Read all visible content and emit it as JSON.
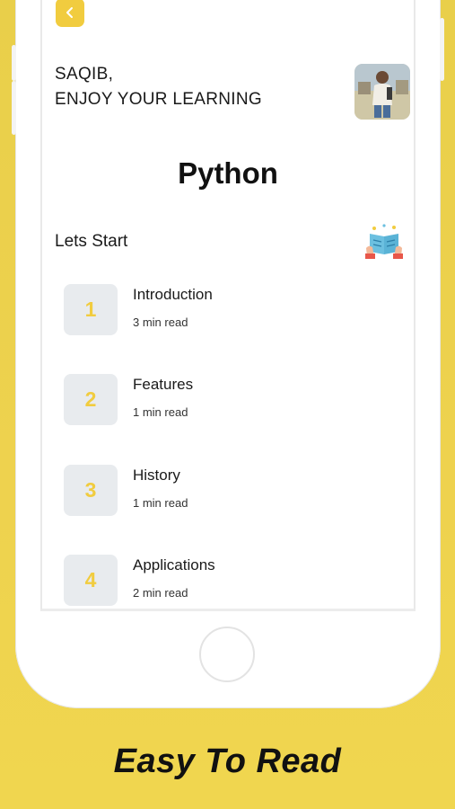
{
  "header": {
    "greeting_line1": "SAQIB,",
    "greeting_line2": "ENJOY YOUR LEARNING"
  },
  "course": {
    "title": "Python"
  },
  "section": {
    "label": "Lets Start"
  },
  "lessons": [
    {
      "number": "1",
      "title": "Introduction",
      "read_time": "3 min read"
    },
    {
      "number": "2",
      "title": "Features",
      "read_time": "1 min read"
    },
    {
      "number": "3",
      "title": "History",
      "read_time": "1 min read"
    },
    {
      "number": "4",
      "title": "Applications",
      "read_time": "2 min read"
    }
  ],
  "caption": "Easy To Read",
  "colors": {
    "accent": "#f1cc3f",
    "background": "#eed24e",
    "tile": "#e8ebee"
  },
  "icons": [
    "back-arrow-icon",
    "book-reading-icon",
    "home-button-icon"
  ]
}
